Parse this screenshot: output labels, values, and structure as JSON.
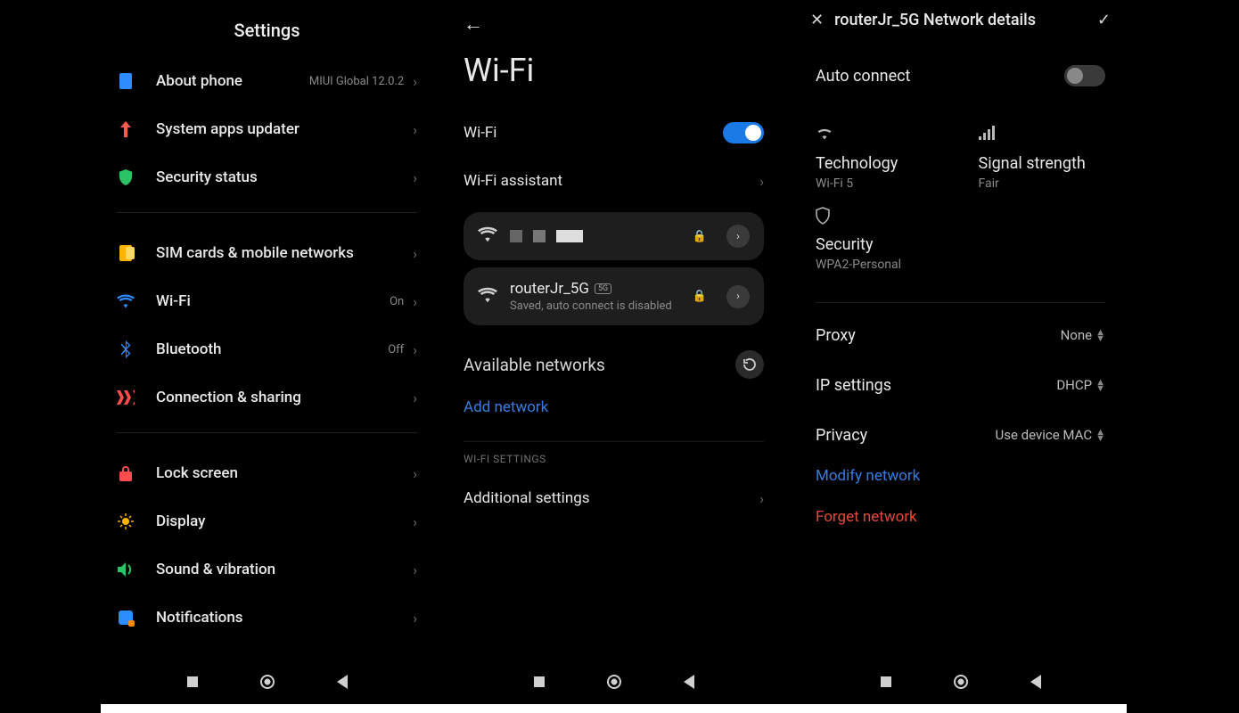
{
  "screen1": {
    "title": "Settings",
    "items": [
      {
        "label": "About phone",
        "meta": "MIUI Global 12.0.2"
      },
      {
        "label": "System apps updater",
        "meta": ""
      },
      {
        "label": "Security status",
        "meta": ""
      },
      {
        "label": "SIM cards & mobile networks",
        "meta": ""
      },
      {
        "label": "Wi-Fi",
        "meta": "On"
      },
      {
        "label": "Bluetooth",
        "meta": "Off"
      },
      {
        "label": "Connection & sharing",
        "meta": ""
      },
      {
        "label": "Lock screen",
        "meta": ""
      },
      {
        "label": "Display",
        "meta": ""
      },
      {
        "label": "Sound & vibration",
        "meta": ""
      },
      {
        "label": "Notifications",
        "meta": ""
      }
    ]
  },
  "screen2": {
    "title": "Wi-Fi",
    "wifi_row": "Wi-Fi",
    "wifi_toggle": true,
    "assistant": "Wi-Fi assistant",
    "connected": {
      "ssid_hidden": true
    },
    "saved": {
      "ssid": "routerJr_5G",
      "badge": "5G",
      "sub": "Saved, auto connect is disabled"
    },
    "available_h": "Available networks",
    "add_network": "Add network",
    "wifi_settings_h": "WI-FI SETTINGS",
    "additional": "Additional settings"
  },
  "screen3": {
    "title": "routerJr_5G Network details",
    "auto_connect": "Auto connect",
    "auto_connect_on": false,
    "tech_k": "Technology",
    "tech_v": "Wi-Fi 5",
    "signal_k": "Signal strength",
    "signal_v": "Fair",
    "security_k": "Security",
    "security_v": "WPA2-Personal",
    "proxy_k": "Proxy",
    "proxy_v": "None",
    "ip_k": "IP settings",
    "ip_v": "DHCP",
    "privacy_k": "Privacy",
    "privacy_v": "Use device MAC",
    "modify": "Modify network",
    "forget": "Forget network"
  }
}
